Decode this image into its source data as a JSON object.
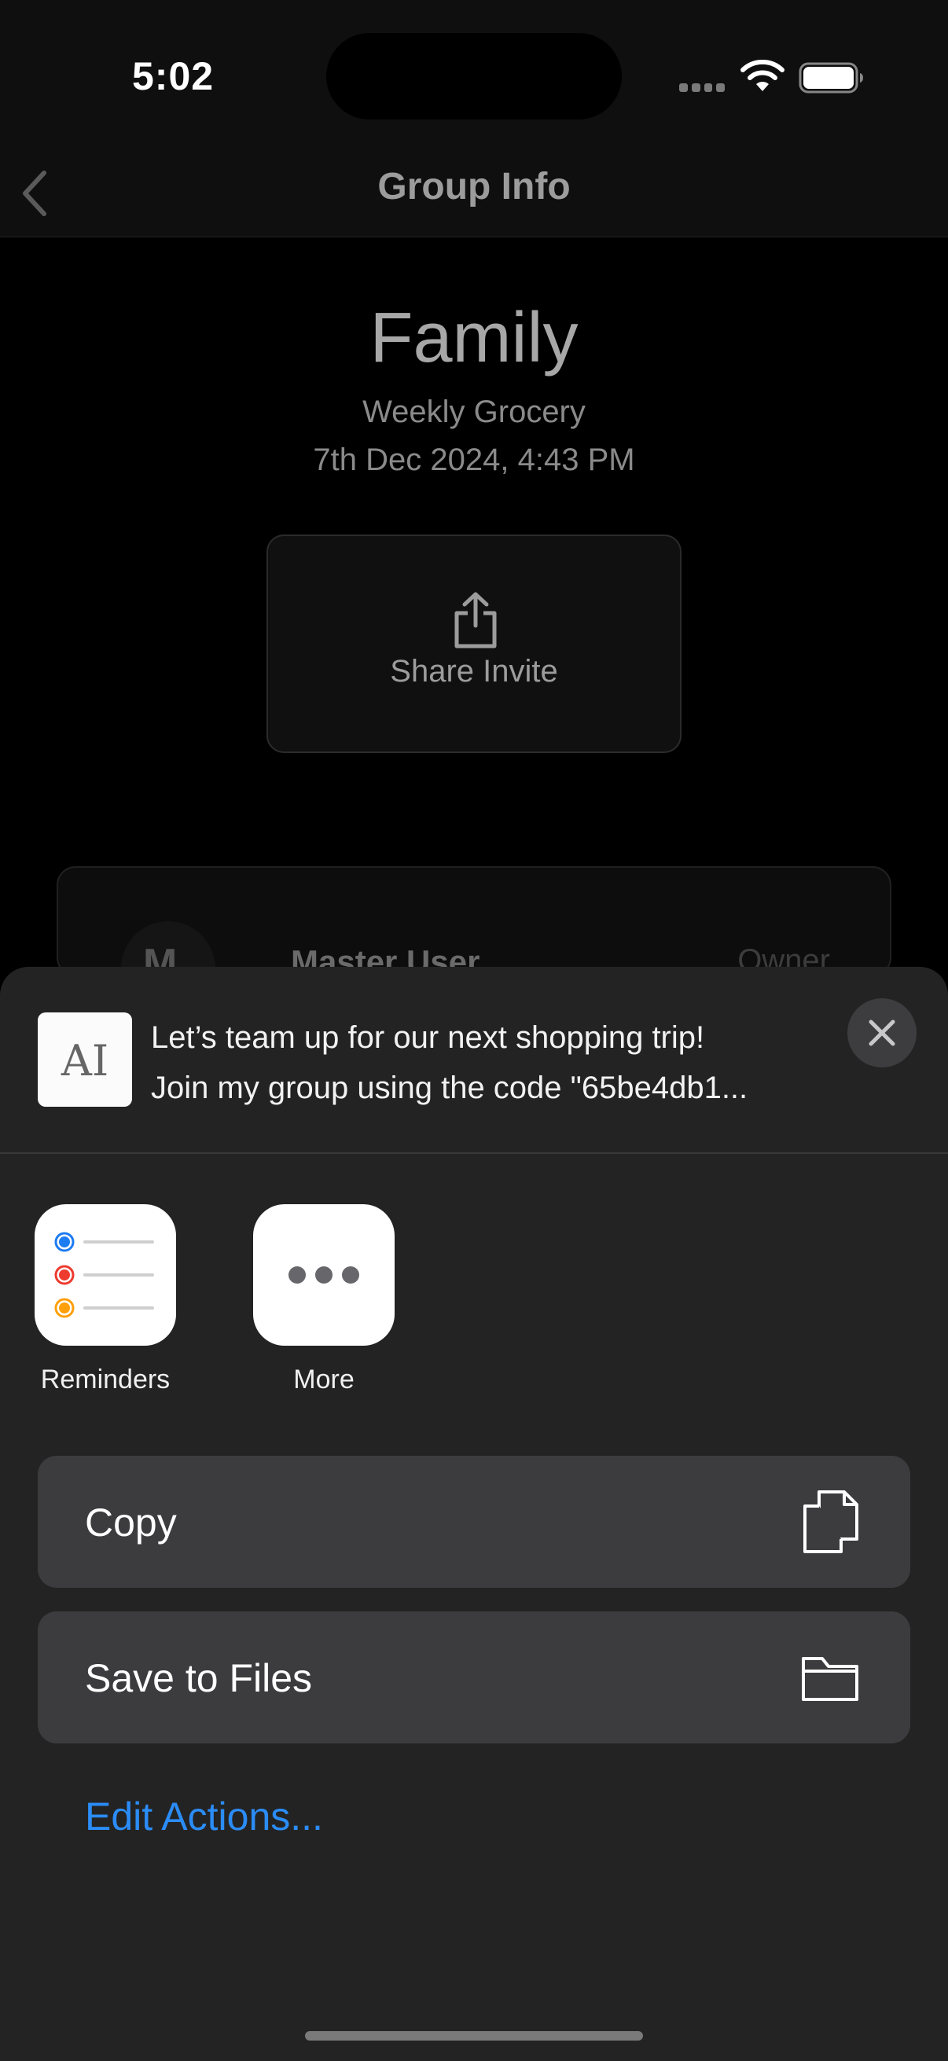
{
  "status_bar": {
    "time": "5:02",
    "signal_icon": "cellular-signal-icon",
    "wifi_icon": "wifi-icon",
    "battery_icon": "battery-icon"
  },
  "nav": {
    "title": "Group Info",
    "back_icon": "chevron-left-icon"
  },
  "group": {
    "name": "Family",
    "subtitle": "Weekly Grocery",
    "date": "7th Dec 2024, 4:43 PM",
    "share_label": "Share Invite",
    "share_icon": "share-upload-icon"
  },
  "members": [
    {
      "avatar_letter": "M",
      "name": "Master User",
      "role": "Owner"
    }
  ],
  "share_sheet": {
    "preview": {
      "thumb_text": "AI",
      "line1": "Let’s team up for our next shopping trip!",
      "line2": "Join my group using the code \"65be4db1..."
    },
    "close_icon": "close-x-icon",
    "apps": [
      {
        "label": "Reminders",
        "icon": "reminders-app-icon"
      },
      {
        "label": "More",
        "icon": "more-dots-icon"
      }
    ],
    "actions": [
      {
        "label": "Copy",
        "icon": "copy-documents-icon"
      },
      {
        "label": "Save to Files",
        "icon": "folder-icon"
      }
    ],
    "edit_actions": "Edit Actions..."
  },
  "colors": {
    "accent_link": "#2b8cf6",
    "sheet_bg": "#232323",
    "action_row_bg": "#3c3c3e",
    "reminder_dot_blue": "#1e7cf2",
    "reminder_dot_red": "#ee3b30",
    "reminder_dot_orange": "#ff9f0a"
  }
}
